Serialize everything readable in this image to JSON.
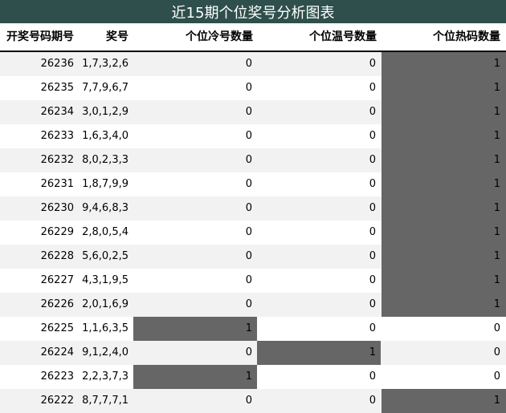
{
  "title": "近15期个位奖号分析图表",
  "headers": {
    "issue": "开奖号码期号",
    "numbers": "奖号",
    "cold": "个位冷号数量",
    "warm": "个位温号数量",
    "hot": "个位热码数量"
  },
  "colors": {
    "title_bg": "#2e4f4b",
    "highlight": "#666666",
    "alt_row": "#f2f2f2"
  },
  "chart_data": {
    "type": "table",
    "title": "近15期个位奖号分析图表",
    "columns": [
      "开奖号码期号",
      "奖号",
      "个位冷号数量",
      "个位温号数量",
      "个位热码数量"
    ],
    "rows": [
      {
        "issue": "26236",
        "numbers": "1,7,3,2,6",
        "cold": 0,
        "warm": 0,
        "hot": 1
      },
      {
        "issue": "26235",
        "numbers": "7,7,9,6,7",
        "cold": 0,
        "warm": 0,
        "hot": 1
      },
      {
        "issue": "26234",
        "numbers": "3,0,1,2,9",
        "cold": 0,
        "warm": 0,
        "hot": 1
      },
      {
        "issue": "26233",
        "numbers": "1,6,3,4,0",
        "cold": 0,
        "warm": 0,
        "hot": 1
      },
      {
        "issue": "26232",
        "numbers": "8,0,2,3,3",
        "cold": 0,
        "warm": 0,
        "hot": 1
      },
      {
        "issue": "26231",
        "numbers": "1,8,7,9,9",
        "cold": 0,
        "warm": 0,
        "hot": 1
      },
      {
        "issue": "26230",
        "numbers": "9,4,6,8,3",
        "cold": 0,
        "warm": 0,
        "hot": 1
      },
      {
        "issue": "26229",
        "numbers": "2,8,0,5,4",
        "cold": 0,
        "warm": 0,
        "hot": 1
      },
      {
        "issue": "26228",
        "numbers": "5,6,0,2,5",
        "cold": 0,
        "warm": 0,
        "hot": 1
      },
      {
        "issue": "26227",
        "numbers": "4,3,1,9,5",
        "cold": 0,
        "warm": 0,
        "hot": 1
      },
      {
        "issue": "26226",
        "numbers": "2,0,1,6,9",
        "cold": 0,
        "warm": 0,
        "hot": 1
      },
      {
        "issue": "26225",
        "numbers": "1,1,6,3,5",
        "cold": 1,
        "warm": 0,
        "hot": 0
      },
      {
        "issue": "26224",
        "numbers": "9,1,2,4,0",
        "cold": 0,
        "warm": 1,
        "hot": 0
      },
      {
        "issue": "26223",
        "numbers": "2,2,3,7,3",
        "cold": 1,
        "warm": 0,
        "hot": 0
      },
      {
        "issue": "26222",
        "numbers": "8,7,7,7,1",
        "cold": 0,
        "warm": 0,
        "hot": 1
      }
    ]
  }
}
